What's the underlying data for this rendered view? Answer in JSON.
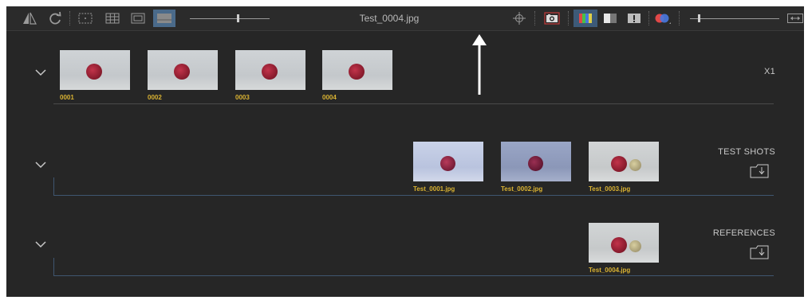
{
  "window": {
    "filename": "Test_0004.jpg"
  },
  "toolbar": {
    "icons": [
      "mirror-icon",
      "rotate-icon",
      "single-view-icon",
      "grid-view-icon",
      "frame-view-icon",
      "filmstrip-view-icon",
      "focus-crosshair-icon",
      "camera-icon",
      "color-view-icon",
      "grayscale-view-icon",
      "exposure-warning-icon",
      "color-compare-icon",
      "expand-width-icon"
    ]
  },
  "sections": [
    {
      "label": "X1",
      "thumbnails": [
        {
          "caption": "0001"
        },
        {
          "caption": "0002"
        },
        {
          "caption": "0003"
        },
        {
          "caption": "0004"
        }
      ]
    },
    {
      "label": "TEST SHOTS",
      "thumbnails": [
        {
          "caption": "Test_0001.jpg"
        },
        {
          "caption": "Test_0002.jpg"
        },
        {
          "caption": "Test_0003.jpg"
        }
      ]
    },
    {
      "label": "REFERENCES",
      "thumbnails": [
        {
          "caption": "Test_0004.jpg"
        }
      ]
    }
  ],
  "colors": {
    "accent_caption": "#d9b232",
    "divider": "#3f5670",
    "background": "#262626"
  }
}
